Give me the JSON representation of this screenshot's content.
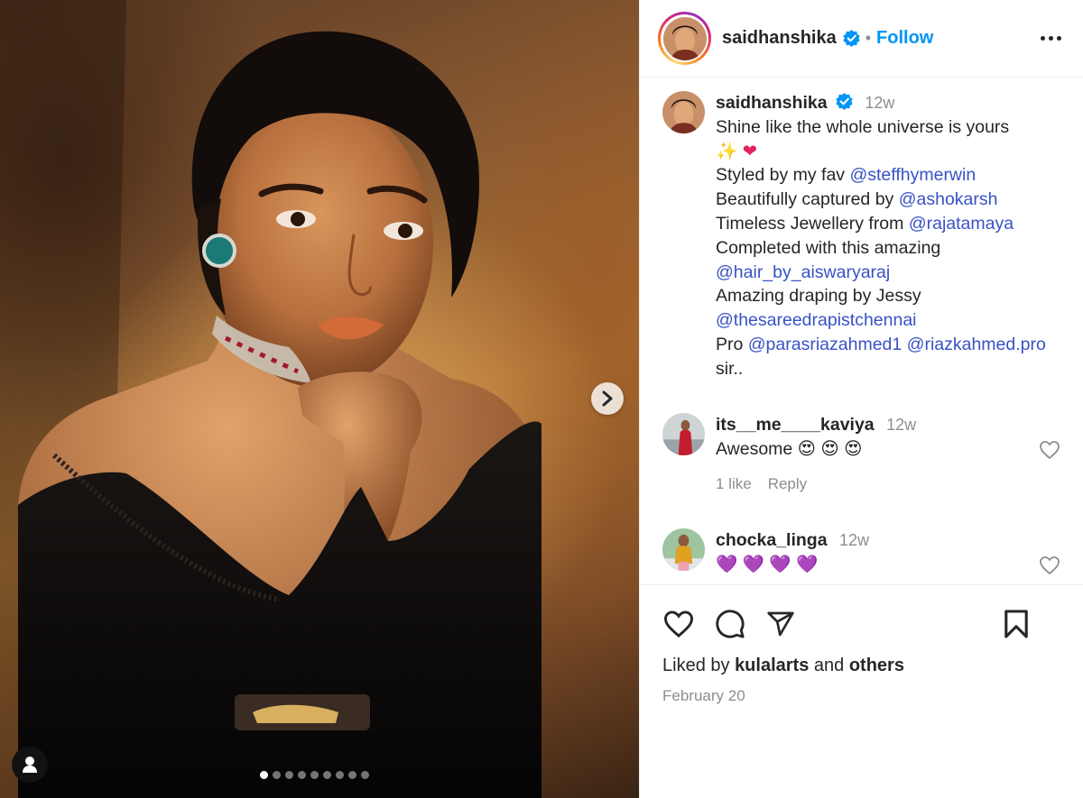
{
  "post": {
    "author": "saidhanshika",
    "follow_label": "Follow",
    "separator": "•",
    "media": {
      "image_count": 9,
      "active_index": 0
    },
    "caption": {
      "username": "saidhanshika",
      "time": "12w",
      "line1": "Shine like the whole universe is yours",
      "emoji1": "✨",
      "emoji2": "❤",
      "styled_prefix": "Styled by my fav ",
      "styled_mention": "@steffhymerwin",
      "captured_prefix": "Beautifully captured by ",
      "captured_mention": "@ashokarsh",
      "jewellery_prefix": "Timeless Jewellery from ",
      "jewellery_mention": "@rajatamaya",
      "completed_text": "Completed with this amazing",
      "hair_mention": "@hair_by_aiswaryaraj",
      "draping_text": "Amazing draping by Jessy",
      "saree_mention": "@thesareedrapistchennai",
      "pro_prefix": "Pro ",
      "pro_mention1": "@parasriazahmed1",
      "pro_mention2": "@riazkahmed.pro",
      "sir_text": "sir.."
    },
    "comments": [
      {
        "username": "its__me____kaviya",
        "time": "12w",
        "text": "Awesome 😍 😍 😍",
        "likes": "1 like",
        "reply_label": "Reply"
      },
      {
        "username": "chocka_linga",
        "time": "12w",
        "text": "💜 💜 💜 💜"
      }
    ],
    "liked_by_prefix": "Liked by ",
    "liked_by_user": "kulalarts",
    "liked_by_and": " and ",
    "liked_by_others": "others",
    "date": "February 20"
  },
  "icons": {
    "like": "heart-outline-icon",
    "comment": "speech-bubble-icon",
    "share": "paper-plane-icon",
    "save": "bookmark-icon",
    "verified": "verified-badge-icon",
    "more": "ellipsis-icon",
    "next": "chevron-right-icon",
    "tags": "user-tag-icon"
  },
  "colors": {
    "link": "#0095f6",
    "mention": "#3852c6",
    "verified": "#0095f6",
    "muted": "#8e8e8e",
    "text": "#262626"
  }
}
